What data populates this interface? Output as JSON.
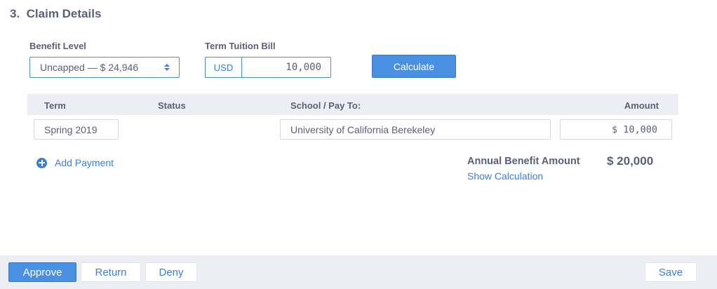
{
  "section": {
    "number": "3.",
    "title": "Claim Details"
  },
  "benefit_level": {
    "label": "Benefit Level",
    "value": "Uncapped — $ 24,946"
  },
  "term_tuition": {
    "label": "Term Tuition Bill",
    "currency": "USD",
    "value": "10,000"
  },
  "calculate_label": "Calculate",
  "table": {
    "headers": {
      "term": "Term",
      "status": "Status",
      "school": "School / Pay To:",
      "amount": "Amount"
    },
    "rows": [
      {
        "term": "Spring 2019",
        "status": "",
        "school": "University of California Berekeley",
        "amount": "$ 10,000"
      }
    ]
  },
  "add_payment_label": "Add Payment",
  "annual": {
    "label": "Annual Benefit Amount",
    "value": "$ 20,000",
    "link": "Show Calculation"
  },
  "footer": {
    "approve": "Approve",
    "return": "Return",
    "deny": "Deny",
    "save": "Save"
  },
  "colors": {
    "accent": "#4a90e2",
    "text": "#5b5f78",
    "link": "#3b7fd0",
    "header_bg": "#edeef3"
  }
}
